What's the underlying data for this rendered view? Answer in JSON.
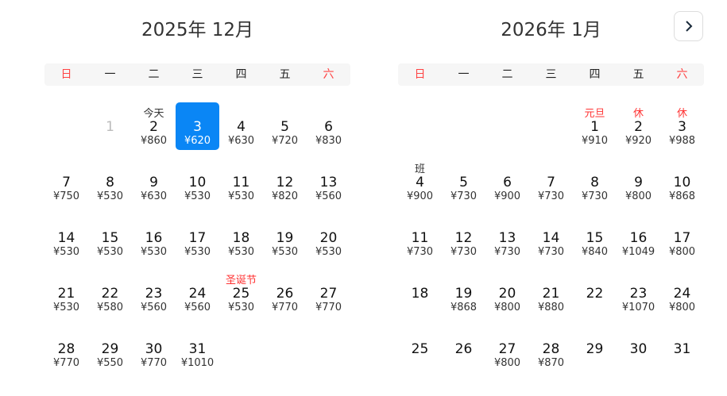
{
  "nav": {
    "next_icon": "chevron-right-icon"
  },
  "colors": {
    "accent": "#0a86f5",
    "holiday": "#ff3333"
  },
  "months": [
    {
      "title": "2025年 12月",
      "weekdays": [
        "日",
        "一",
        "二",
        "三",
        "四",
        "五",
        "六"
      ],
      "weeks": [
        [
          null,
          {
            "d": "1",
            "disabled": true
          },
          {
            "d": "2",
            "p": "¥860",
            "tag": "今天"
          },
          {
            "d": "3",
            "p": "¥620",
            "sel": true
          },
          {
            "d": "4",
            "p": "¥630"
          },
          {
            "d": "5",
            "p": "¥720"
          },
          {
            "d": "6",
            "p": "¥830"
          }
        ],
        [
          {
            "d": "7",
            "p": "¥750"
          },
          {
            "d": "8",
            "p": "¥530"
          },
          {
            "d": "9",
            "p": "¥630"
          },
          {
            "d": "10",
            "p": "¥530"
          },
          {
            "d": "11",
            "p": "¥530"
          },
          {
            "d": "12",
            "p": "¥820"
          },
          {
            "d": "13",
            "p": "¥560"
          }
        ],
        [
          {
            "d": "14",
            "p": "¥530"
          },
          {
            "d": "15",
            "p": "¥530"
          },
          {
            "d": "16",
            "p": "¥530"
          },
          {
            "d": "17",
            "p": "¥530"
          },
          {
            "d": "18",
            "p": "¥530"
          },
          {
            "d": "19",
            "p": "¥530"
          },
          {
            "d": "20",
            "p": "¥530"
          }
        ],
        [
          {
            "d": "21",
            "p": "¥530"
          },
          {
            "d": "22",
            "p": "¥580"
          },
          {
            "d": "23",
            "p": "¥560"
          },
          {
            "d": "24",
            "p": "¥560"
          },
          {
            "d": "25",
            "p": "¥530",
            "tag": "圣诞节",
            "red": true
          },
          {
            "d": "26",
            "p": "¥770"
          },
          {
            "d": "27",
            "p": "¥770"
          }
        ],
        [
          {
            "d": "28",
            "p": "¥770"
          },
          {
            "d": "29",
            "p": "¥550"
          },
          {
            "d": "30",
            "p": "¥770"
          },
          {
            "d": "31",
            "p": "¥1010"
          },
          null,
          null,
          null
        ]
      ]
    },
    {
      "title": "2026年 1月",
      "weekdays": [
        "日",
        "一",
        "二",
        "三",
        "四",
        "五",
        "六"
      ],
      "weeks": [
        [
          null,
          null,
          null,
          null,
          {
            "d": "1",
            "p": "¥910",
            "tag": "元旦",
            "red": true
          },
          {
            "d": "2",
            "p": "¥920",
            "tag": "休",
            "red": true
          },
          {
            "d": "3",
            "p": "¥988",
            "tag": "休",
            "red": true
          }
        ],
        [
          {
            "d": "4",
            "p": "¥900",
            "tag": "班"
          },
          {
            "d": "5",
            "p": "¥730"
          },
          {
            "d": "6",
            "p": "¥900"
          },
          {
            "d": "7",
            "p": "¥730"
          },
          {
            "d": "8",
            "p": "¥730"
          },
          {
            "d": "9",
            "p": "¥800"
          },
          {
            "d": "10",
            "p": "¥868"
          }
        ],
        [
          {
            "d": "11",
            "p": "¥730"
          },
          {
            "d": "12",
            "p": "¥730"
          },
          {
            "d": "13",
            "p": "¥730"
          },
          {
            "d": "14",
            "p": "¥730"
          },
          {
            "d": "15",
            "p": "¥840"
          },
          {
            "d": "16",
            "p": "¥1049"
          },
          {
            "d": "17",
            "p": "¥800"
          }
        ],
        [
          {
            "d": "18"
          },
          {
            "d": "19",
            "p": "¥868"
          },
          {
            "d": "20",
            "p": "¥800"
          },
          {
            "d": "21",
            "p": "¥880"
          },
          {
            "d": "22"
          },
          {
            "d": "23",
            "p": "¥1070"
          },
          {
            "d": "24",
            "p": "¥800"
          }
        ],
        [
          {
            "d": "25"
          },
          {
            "d": "26"
          },
          {
            "d": "27",
            "p": "¥800"
          },
          {
            "d": "28",
            "p": "¥870"
          },
          {
            "d": "29"
          },
          {
            "d": "30"
          },
          {
            "d": "31"
          }
        ]
      ]
    }
  ]
}
